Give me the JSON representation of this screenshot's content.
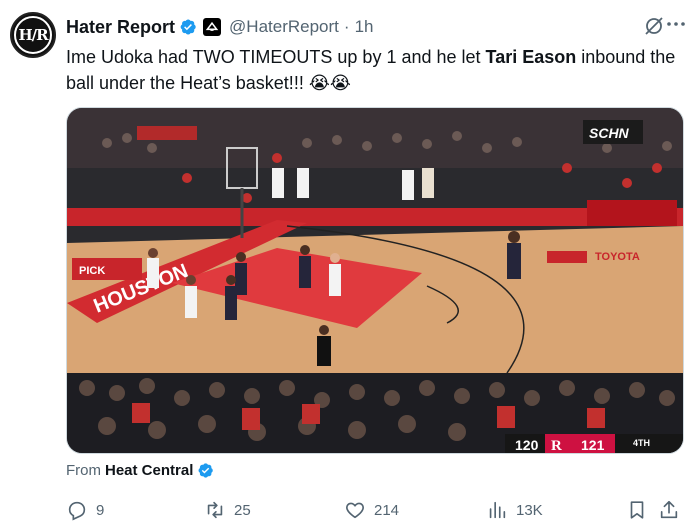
{
  "tweet": {
    "avatar_text": "H/R",
    "display_name": "Hater Report",
    "handle": "@HaterReport",
    "separator": "·",
    "time": "1h",
    "text_part1": "Ime Udoka had TWO TIMEOUTS up by 1 and he let ",
    "text_bold": "Tari Eason",
    "text_part2": " inbound the ball under the Heat’s basket!!! 😭😭",
    "source_prefix": "From",
    "source_name": "Heat Central"
  },
  "video": {
    "scoreboard": {
      "away_score": "120",
      "home_score": "121",
      "period": "4TH",
      "home_logo": "R"
    },
    "court_text_left": "HOUSTON",
    "court_text_sponsor": "TOYOTA",
    "sponsor_board": "PICK",
    "colors": {
      "court": "#d9a574",
      "paint": "#e03a3e",
      "crowd": "#2a2a2e"
    }
  },
  "actions": {
    "replies": "9",
    "retweets": "25",
    "likes": "214",
    "views": "13K"
  },
  "colors": {
    "verified": "#1d9bf0",
    "text_secondary": "#536471"
  }
}
